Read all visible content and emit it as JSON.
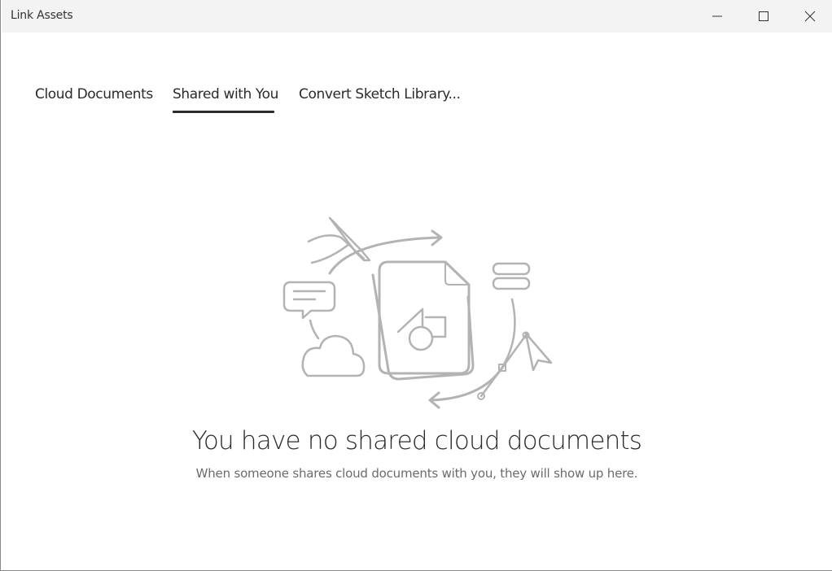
{
  "window": {
    "title": "Link Assets",
    "controls": {
      "minimize_icon": "minimize-icon",
      "maximize_icon": "maximize-icon",
      "close_icon": "close-icon"
    }
  },
  "tabs": [
    {
      "label": "Cloud Documents",
      "selected": false
    },
    {
      "label": "Shared with You",
      "selected": true
    },
    {
      "label": "Convert Sketch Library...",
      "selected": false
    }
  ],
  "empty_state": {
    "illustration_icon": "shared-documents-illustration",
    "title": "You have no shared cloud documents",
    "subtitle": "When someone shares cloud documents with you, they will show up here."
  },
  "colors": {
    "titlebar_bg": "#f3f3f3",
    "text_primary": "#2b2b2b",
    "text_secondary": "#6b6b6b",
    "illustration_stroke": "#b3b3b3"
  }
}
